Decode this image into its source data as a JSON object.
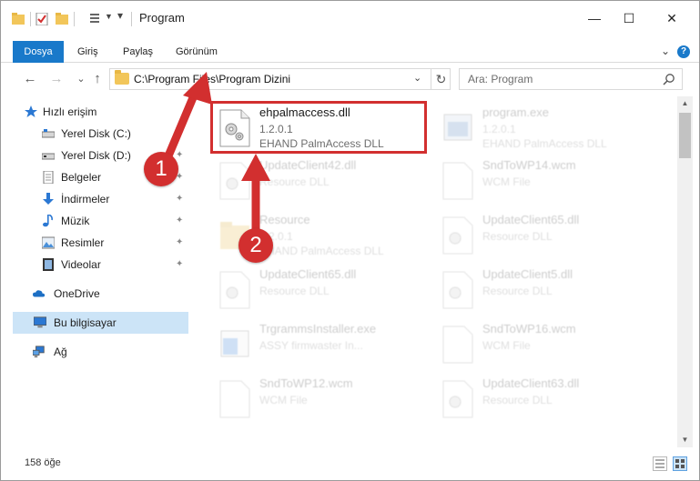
{
  "window": {
    "title": "Program",
    "minimize_glyph": "—",
    "maximize_glyph": "☐",
    "close_glyph": "✕"
  },
  "ribbon": {
    "tabs": [
      "Dosya",
      "Giriş",
      "Paylaş",
      "Görünüm"
    ],
    "help_glyph": "?",
    "collapse_glyph": "⌄",
    "accent": "#1979ca"
  },
  "navigation": {
    "back_glyph": "←",
    "forward_glyph": "→",
    "recent_glyph": "⌄",
    "up_glyph": "↑",
    "address": "C:\\Program Files\\Program Dizini",
    "address_dropdown_glyph": "⌄",
    "refresh_glyph": "↻",
    "search_placeholder": "Ara: Program"
  },
  "sidebar": {
    "items": [
      {
        "label": "Hızlı erişim",
        "icon": "star-icon",
        "pinned": false
      },
      {
        "label": "Yerel Disk (C:)",
        "icon": "drive-icon",
        "pinned": true
      },
      {
        "label": "Yerel Disk (D:)",
        "icon": "drive-icon",
        "pinned": true
      },
      {
        "label": "Belgeler",
        "icon": "documents-icon",
        "pinned": true
      },
      {
        "label": "İndirmeler",
        "icon": "downloads-icon",
        "pinned": true
      },
      {
        "label": "Müzik",
        "icon": "music-icon",
        "pinned": true
      },
      {
        "label": "Resimler",
        "icon": "pictures-icon",
        "pinned": true
      },
      {
        "label": "Videolar",
        "icon": "videos-icon",
        "pinned": true
      },
      {
        "label": "OneDrive",
        "icon": "cloud-icon",
        "pinned": false
      },
      {
        "label": "Bu bilgisayar",
        "icon": "computer-icon",
        "pinned": false,
        "selected": true
      },
      {
        "label": "Ağ",
        "icon": "network-icon",
        "pinned": false
      }
    ],
    "pin_glyph": "📌"
  },
  "files": [
    {
      "name": "ehpalmaccess.dll",
      "line1": "1.2.0.1",
      "line2": "EHAND PalmAccess  DLL",
      "type": "dll",
      "highlighted": true
    },
    {
      "name": "program.exe",
      "line1": "1.2.0.1",
      "line2": "EHAND PalmAccess  DLL",
      "type": "exe",
      "highlighted": false
    },
    {
      "name": "UpdateClient42.dll",
      "line1": "Resource DLL",
      "line2": "",
      "type": "dll",
      "highlighted": false
    },
    {
      "name": "SndToWP14.wcm",
      "line1": "WCM File",
      "line2": "",
      "type": "doc",
      "highlighted": false
    },
    {
      "name": "Resource",
      "line1": "1.2.0.1",
      "line2": "EHAND PalmAccess  DLL",
      "type": "folder",
      "highlighted": false
    },
    {
      "name": "UpdateClient65.dll",
      "line1": "Resource DLL",
      "line2": "",
      "type": "dll",
      "highlighted": false
    },
    {
      "name": "UpdateClient65.dll",
      "line1": "Resource DLL",
      "line2": "",
      "type": "dll",
      "highlighted": false
    },
    {
      "name": "UpdateClient5.dll",
      "line1": "Resource DLL",
      "line2": "",
      "type": "dll",
      "highlighted": false
    },
    {
      "name": "TrgrammsInstaller.exe",
      "line1": "ASSY firmwaster In...",
      "line2": "",
      "type": "installer",
      "highlighted": false
    },
    {
      "name": "SndToWP16.wcm",
      "line1": "WCM File",
      "line2": "",
      "type": "doc",
      "highlighted": false
    },
    {
      "name": "SndToWP12.wcm",
      "line1": "WCM File",
      "line2": "",
      "type": "doc",
      "highlighted": false
    },
    {
      "name": "UpdateClient63.dll",
      "line1": "Resource DLL",
      "line2": "",
      "type": "dll",
      "highlighted": false
    }
  ],
  "status": {
    "item_count": "158 öğe"
  },
  "annotations": {
    "badge1": "1",
    "badge2": "2",
    "color": "#d22f2f"
  }
}
